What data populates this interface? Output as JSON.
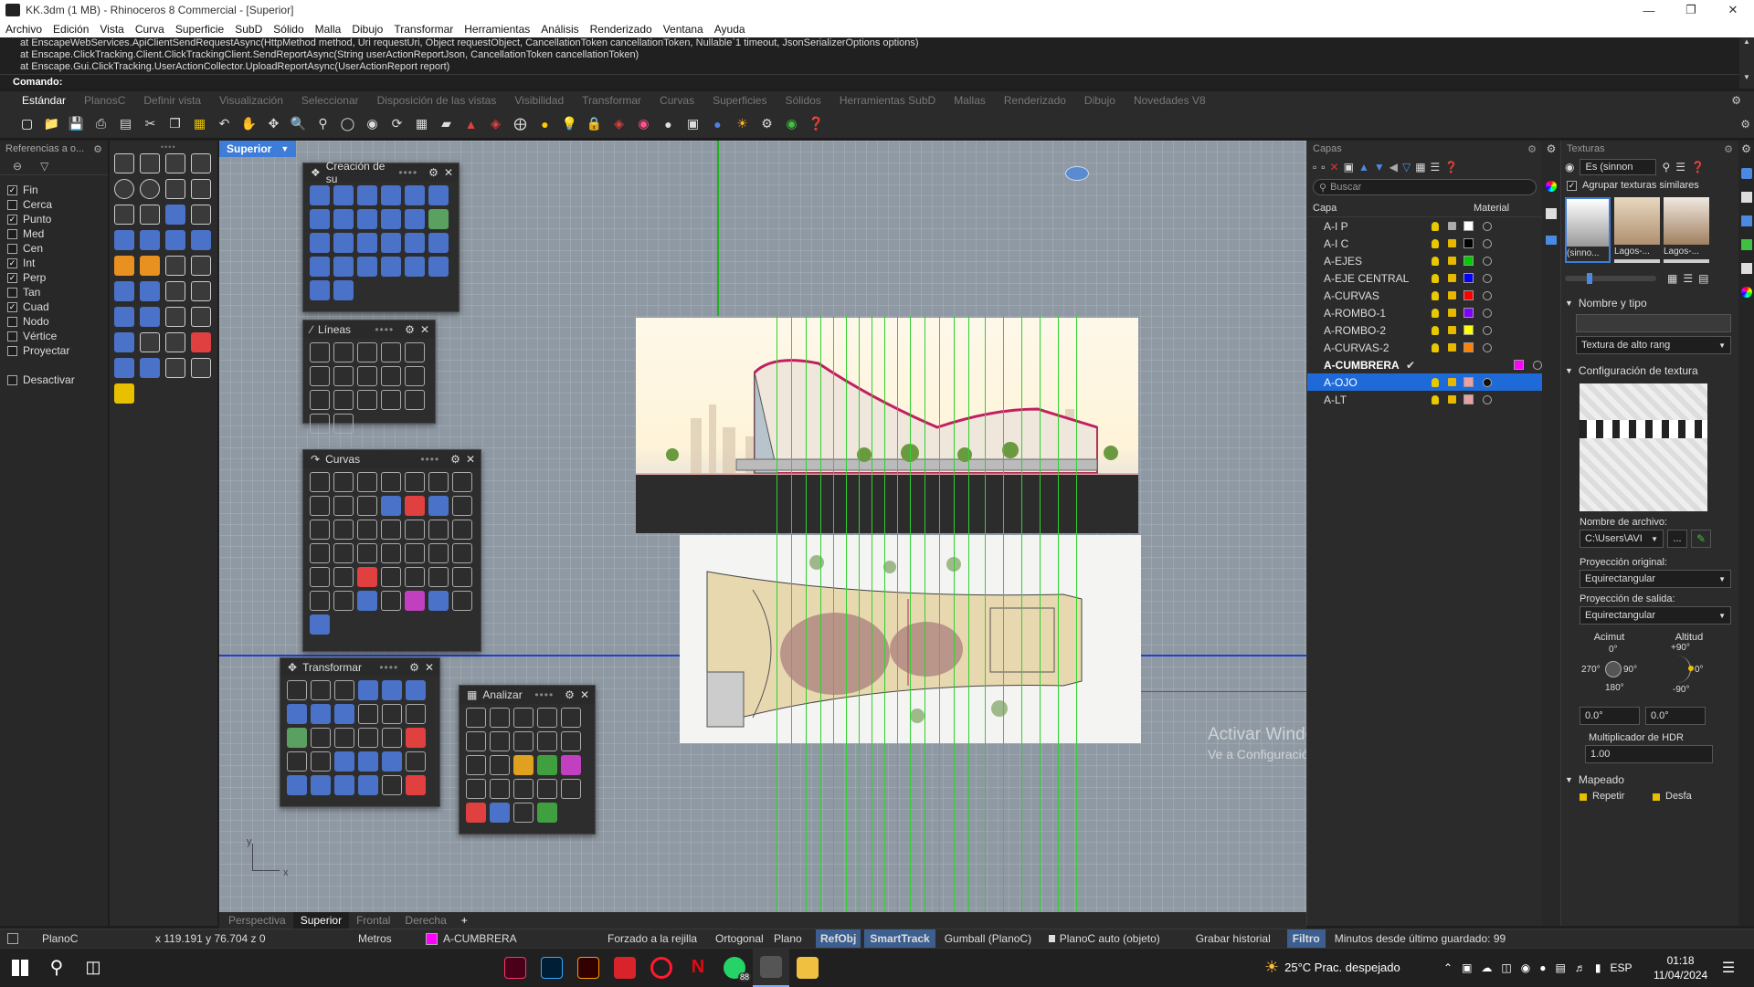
{
  "window": {
    "title": "KK.3dm (1 MB) - Rhinoceros 8 Commercial - [Superior]"
  },
  "menu": [
    "Archivo",
    "Edición",
    "Vista",
    "Curva",
    "Superficie",
    "SubD",
    "Sólido",
    "Malla",
    "Dibujo",
    "Transformar",
    "Herramientas",
    "Análisis",
    "Renderizado",
    "Ventana",
    "Ayuda"
  ],
  "command_history": [
    "at EnscapeWebServices.ApiClientSendRequestAsync(HttpMethod method, Uri requestUri, Object requestObject, CancellationToken cancellationToken, Nullable`1 timeout, JsonSerializerOptions options)",
    "at Enscape.ClickTracking.Client.ClickTrackingClient.SendReportAsync(String userActionReportJson, CancellationToken cancellationToken)",
    "at Enscape.Gui.ClickTracking.UserActionCollector.UploadReportAsync(UserActionReport report)"
  ],
  "command_prompt": "Comando:",
  "toolbar_tabs": [
    "Estándar",
    "PlanosC",
    "Definir vista",
    "Visualización",
    "Seleccionar",
    "Disposición de las vistas",
    "Visibilidad",
    "Transformar",
    "Curvas",
    "Superficies",
    "Sólidos",
    "Herramientas SubD",
    "Mallas",
    "Renderizado",
    "Dibujo",
    "Novedades V8"
  ],
  "osnap": {
    "header": "Referencias a o...",
    "items": [
      {
        "label": "Fin",
        "checked": true
      },
      {
        "label": "Cerca",
        "checked": false
      },
      {
        "label": "Punto",
        "checked": true
      },
      {
        "label": "Med",
        "checked": false
      },
      {
        "label": "Cen",
        "checked": false
      },
      {
        "label": "Int",
        "checked": true
      },
      {
        "label": "Perp",
        "checked": true
      },
      {
        "label": "Tan",
        "checked": false
      },
      {
        "label": "Cuad",
        "checked": true
      },
      {
        "label": "Nodo",
        "checked": false
      },
      {
        "label": "Vértice",
        "checked": false
      },
      {
        "label": "Proyectar",
        "checked": false
      }
    ],
    "disable": "Desactivar"
  },
  "viewport": {
    "name": "Superior",
    "tabs": [
      "Perspectiva",
      "Superior",
      "Frontal",
      "Derecha"
    ],
    "active_tab": "Superior",
    "add": "+",
    "axis_y": "y",
    "axis_x": "x"
  },
  "panels": {
    "creation": "Creación de su",
    "lines": "Líneas",
    "curves": "Curvas",
    "transform": "Transformar",
    "analyze": "Analizar"
  },
  "layers": {
    "title": "Capas",
    "search_placeholder": "Buscar",
    "col_layer": "Capa",
    "col_material": "Material",
    "rows": [
      {
        "name": "A-I P",
        "color": "#ffffff",
        "current": false,
        "selected": false
      },
      {
        "name": "A-I C",
        "color": "#000000",
        "current": false,
        "selected": false
      },
      {
        "name": "A-EJES",
        "color": "#00cc00",
        "current": false,
        "selected": false
      },
      {
        "name": "A-EJE CENTRAL",
        "color": "#0000ff",
        "current": false,
        "selected": false
      },
      {
        "name": "A-CURVAS",
        "color": "#ff0000",
        "current": false,
        "selected": false
      },
      {
        "name": "A-ROMBO-1",
        "color": "#7f00ff",
        "current": false,
        "selected": false
      },
      {
        "name": "A-ROMBO-2",
        "color": "#ffff00",
        "current": false,
        "selected": false
      },
      {
        "name": "A-CURVAS-2",
        "color": "#ff8000",
        "current": false,
        "selected": false
      },
      {
        "name": "A-CUMBRERA",
        "color": "#ff00ff",
        "current": true,
        "selected": false
      },
      {
        "name": "A-OJO",
        "color": "#e8a0a0",
        "current": false,
        "selected": true
      },
      {
        "name": "A-LT",
        "color": "#e8a0a0",
        "current": false,
        "selected": false
      }
    ]
  },
  "textures": {
    "title": "Texturas",
    "filter_value": "Es (sinnon",
    "group_similar": "Agrupar texturas similares",
    "thumbs": [
      "(sinno...",
      "Lagos-...",
      "Lagos-..."
    ],
    "section_name": "Nombre y tipo",
    "type_value": "Textura de alto rang",
    "section_config": "Configuración de textura",
    "filename_label": "Nombre de archivo:",
    "filename_value": "C:\\Users\\AVI",
    "browse": "...",
    "proj_orig_label": "Proyección original:",
    "proj_orig_value": "Equirectangular",
    "proj_out_label": "Proyección de salida:",
    "proj_out_value": "Equirectangular",
    "azimuth_label": "Acimut",
    "altitude_label": "Altitud",
    "az_top": "0°",
    "az_left": "270°",
    "az_right": "90°",
    "az_bottom": "180°",
    "alt_top": "+90°",
    "alt_right": "0°",
    "alt_bottom": "-90°",
    "az_value": "0.0°",
    "alt_value": "0.0°",
    "hdr_label": "Multiplicador de HDR",
    "hdr_value": "1.00",
    "section_mapping": "Mapeado",
    "repeat": "Repetir",
    "offset": "Desfa"
  },
  "activate_windows": {
    "title": "Activar Windows",
    "subtitle": "Ve a Configuración para activar Windows."
  },
  "status": {
    "cplane": "PlanoC",
    "coords": "x 119.191  y 76.704  z 0",
    "units": "Metros",
    "layer": "A-CUMBRERA",
    "layer_color": "#ff00ff",
    "snap_grid": "Forzado a la rejilla",
    "ortho": "Ortogonal",
    "planar": "Plano",
    "refobj": "RefObj",
    "smarttrack": "SmartTrack",
    "gumball": "Gumball (PlanoC)",
    "cplane_auto": "PlanoC auto (objeto)",
    "history": "Grabar historial",
    "filter": "Filtro",
    "saved": "Minutos desde último guardado: 99"
  },
  "taskbar": {
    "weather": "25°C  Prac. despejado",
    "lang": "ESP",
    "time": "01:18",
    "date": "11/04/2024",
    "badge": "88"
  }
}
